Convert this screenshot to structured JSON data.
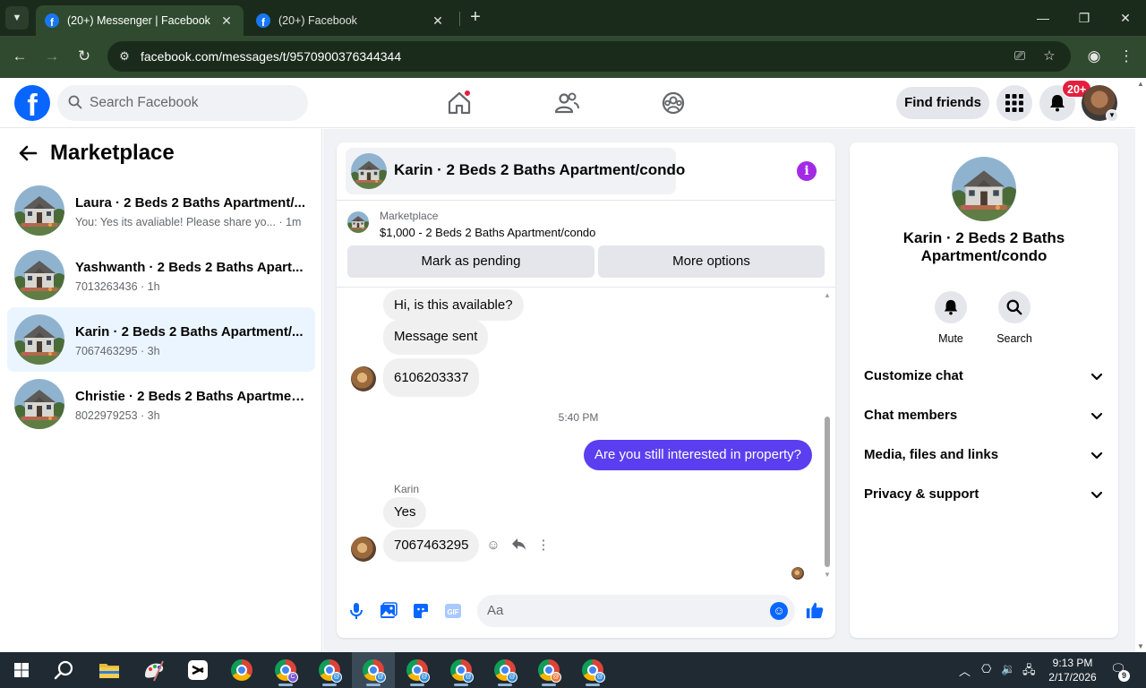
{
  "browser": {
    "tabs": [
      {
        "title": "(20+) Messenger | Facebook",
        "active": true
      },
      {
        "title": "(20+) Facebook",
        "active": false
      }
    ],
    "url": "facebook.com/messages/t/9570900376344344",
    "tab_close_glyph": "✕",
    "new_tab_glyph": "+"
  },
  "header": {
    "search_placeholder": "Search Facebook",
    "find_friends_label": "Find friends",
    "notification_badge": "20+"
  },
  "sidebar": {
    "title": "Marketplace",
    "conversations": [
      {
        "name": "Laura · 2 Beds 2 Baths Apartment/...",
        "subtitle": "You: Yes its avaliable! Please share yo... · 1m",
        "selected": false
      },
      {
        "name": "Yashwanth · 2 Beds 2 Baths Apart...",
        "subtitle": "7013263436 · 1h",
        "selected": false
      },
      {
        "name": "Karin · 2 Beds 2 Baths Apartment/...",
        "subtitle": "7067463295 · 3h",
        "selected": true
      },
      {
        "name": "Christie · 2 Beds 2 Baths Apartmen...",
        "subtitle": "8022979253 · 3h",
        "selected": false
      }
    ]
  },
  "chat": {
    "title": "Karin · 2 Beds 2 Baths Apartment/condo",
    "info_glyph": "i",
    "marketplace_label": "Marketplace",
    "listing": "$1,000 - 2 Beds 2 Baths Apartment/condo",
    "mark_pending_label": "Mark as pending",
    "more_options_label": "More options",
    "messages": [
      {
        "text": "Hi, is this available?",
        "from": "them"
      },
      {
        "text": "Message sent",
        "from": "them"
      },
      {
        "text": "6106203337",
        "from": "them"
      },
      {
        "text": "Are you still interested in property?",
        "from": "me"
      },
      {
        "text": "Yes",
        "from": "them"
      },
      {
        "text": "7067463295",
        "from": "them"
      }
    ],
    "timestamp": "5:40 PM",
    "sender_name": "Karin",
    "composer_placeholder": "Aa",
    "accent_color": "#5b3ef0"
  },
  "info_panel": {
    "title": "Karin · 2 Beds 2 Baths Apartment/condo",
    "mute_label": "Mute",
    "search_label": "Search",
    "sections": [
      "Customize chat",
      "Chat members",
      "Media, files and links",
      "Privacy & support"
    ]
  },
  "taskbar": {
    "time": "9:13 PM",
    "date": "2/17/2026",
    "notification_count": "9",
    "chrome_profile_badges": [
      "C",
      "@",
      "@",
      "@",
      "@",
      "@",
      "@",
      "@"
    ]
  }
}
